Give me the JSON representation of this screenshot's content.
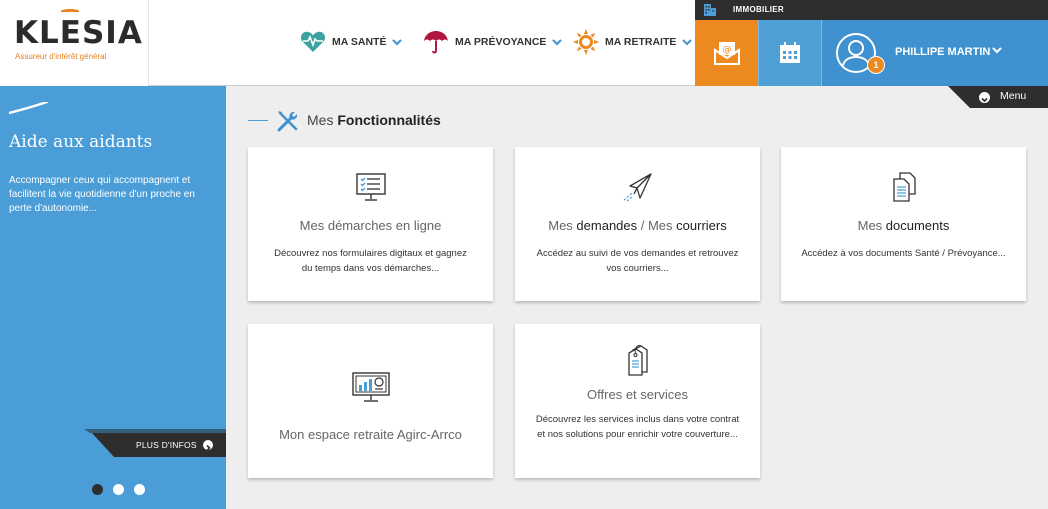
{
  "header": {
    "logo": {
      "name": "KLESIA",
      "tagline": "Assureur d'intérêt général"
    },
    "nav": [
      {
        "label": "MA SANTÉ",
        "icon": "heart-pulse-icon"
      },
      {
        "label": "MA PRÉVOYANCE",
        "icon": "umbrella-icon"
      },
      {
        "label": "MA RETRAITE",
        "icon": "sun-icon"
      }
    ],
    "immobilier": "IMMOBILIER",
    "user": {
      "name": "PHILLIPE MARTIN",
      "notifications": "1"
    }
  },
  "menu": {
    "label": "Menu"
  },
  "sidebar": {
    "title": "Aide aux aidants",
    "text": "Accompagner ceux qui accompagnent et facilitent la vie quotidienne d'un proche en perte d'autonomie...",
    "more": "PLUS D'INFOS",
    "slides": 3,
    "active_slide": 1
  },
  "section": {
    "title_light": "Mes ",
    "title_bold": "Fonctionnalités"
  },
  "cards": [
    {
      "title": "Mes démarches en ligne",
      "description": "Découvrez nos formulaires digitaux et gagnez du temps dans vos démarches...",
      "icon": "monitor-checklist-icon"
    },
    {
      "title": "Mes demandes / Mes courriers",
      "description": "Accédez au suivi de vos demandes et retrouvez vos courriers...",
      "icon": "paper-plane-icon"
    },
    {
      "title": "Mes documents",
      "description": "Accédez à vos documents Santé / Prévoyance...",
      "icon": "documents-icon"
    },
    {
      "title": "Mon espace retraite Agirc-Arrco",
      "description": "",
      "icon": "monitor-chart-icon"
    },
    {
      "title": "Offres et services",
      "description": "Découvrez les services inclus dans votre contrat et nos solutions pour enrichir votre couverture...",
      "icon": "price-tags-icon"
    }
  ],
  "colors": {
    "blue": "#4a9dd6",
    "orange": "#ed8a1f",
    "dark": "#2e2e2e",
    "health": "#3aa3a0",
    "umbrella": "#b0163f"
  }
}
